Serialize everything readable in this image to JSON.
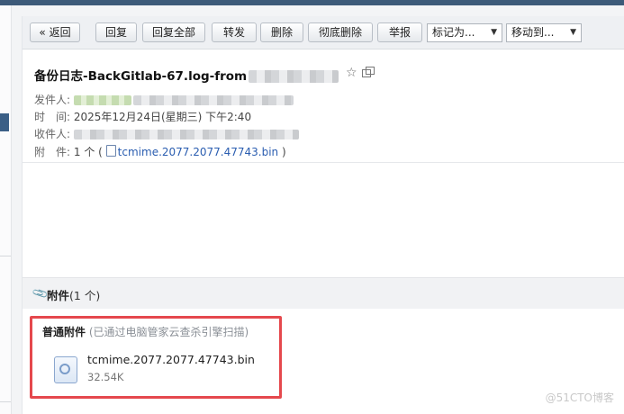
{
  "toolbar": {
    "back": "« 返回",
    "reply": "回复",
    "reply_all": "回复全部",
    "forward": "转发",
    "delete": "删除",
    "delete_permanently": "彻底删除",
    "report": "举报",
    "mark_as": "标记为...",
    "move_to": "移动到..."
  },
  "email": {
    "subject": "备份日志-BackGitlab-67.log-from",
    "sender_label": "发件人:",
    "time_label": "时　间:",
    "time_value": "2025年12月24日(星期三) 下午2:40",
    "recipient_label": "收件人:",
    "attachment_label": "附　件:",
    "attachment_count": "1 个",
    "attachment_name": "tcmime.2077.2077.47743.bin"
  },
  "attachments": {
    "title": "附件",
    "count": "(1 个)",
    "normal_label": "普通附件",
    "scan_note": "(已通过电脑管家云查杀引擎扫描)",
    "file_name": "tcmime.2077.2077.47743.bin",
    "file_size": "32.54K"
  },
  "watermark": "@51CTO博客",
  "icons": [
    "star-icon",
    "popout-icon",
    "file-icon",
    "paperclip-icon",
    "attachment-file-icon"
  ],
  "colors": {
    "header_bar": "#3d5a79",
    "link": "#2a5db0",
    "highlight": "#e5484d"
  }
}
